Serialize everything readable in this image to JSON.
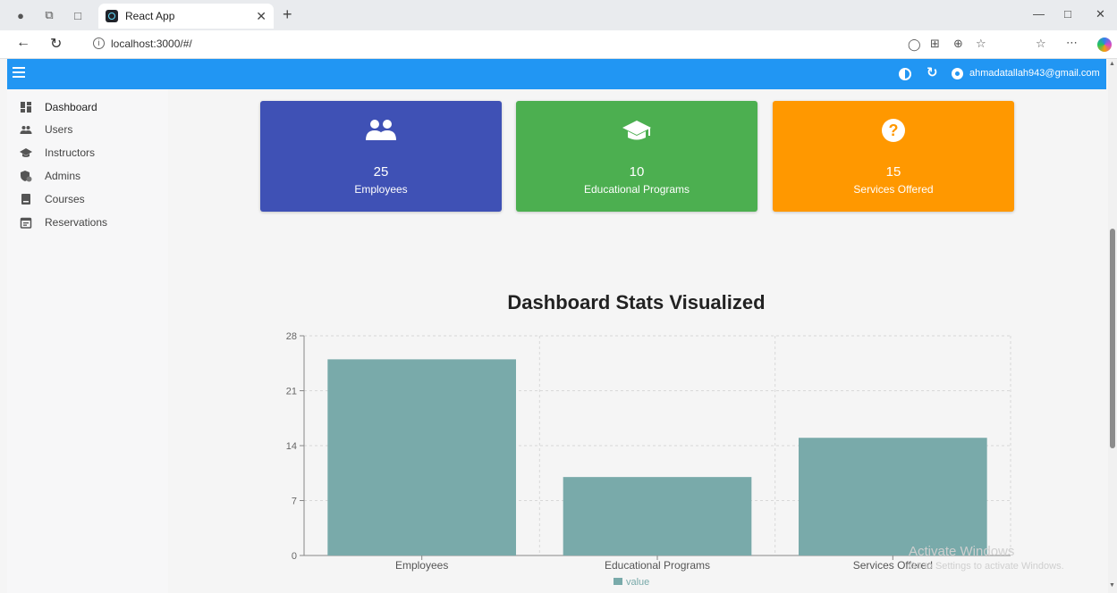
{
  "browser": {
    "tab_title": "React App",
    "url": "localhost:3000/#/"
  },
  "header": {
    "user_email": "ahmadatallah943@gmail.com"
  },
  "sidebar": {
    "items": [
      {
        "label": "Dashboard",
        "icon": "dashboard-icon"
      },
      {
        "label": "Users",
        "icon": "people-icon"
      },
      {
        "label": "Instructors",
        "icon": "school-icon"
      },
      {
        "label": "Admins",
        "icon": "admin-icon"
      },
      {
        "label": "Courses",
        "icon": "book-icon"
      },
      {
        "label": "Reservations",
        "icon": "calendar-icon"
      }
    ]
  },
  "cards": [
    {
      "value": "25",
      "label": "Employees",
      "color": "#3f51b5",
      "icon": "people-icon"
    },
    {
      "value": "10",
      "label": "Educational Programs",
      "color": "#4caf50",
      "icon": "school-icon"
    },
    {
      "value": "15",
      "label": "Services Offered",
      "color": "#ff9800",
      "icon": "help-icon"
    }
  ],
  "chart_title": "Dashboard Stats Visualized",
  "chart_data": {
    "type": "bar",
    "title": "Dashboard Stats Visualized",
    "categories": [
      "Employees",
      "Educational Programs",
      "Services Offered"
    ],
    "series": [
      {
        "name": "value",
        "values": [
          25,
          10,
          15
        ],
        "color": "#79aaaa"
      }
    ],
    "yticks": [
      0,
      7,
      14,
      21,
      28
    ],
    "ylim": [
      0,
      28
    ],
    "grid": true,
    "legend": "bottom"
  },
  "watermark": {
    "line1": "Activate Windows",
    "line2": "Go to Settings to activate Windows."
  }
}
